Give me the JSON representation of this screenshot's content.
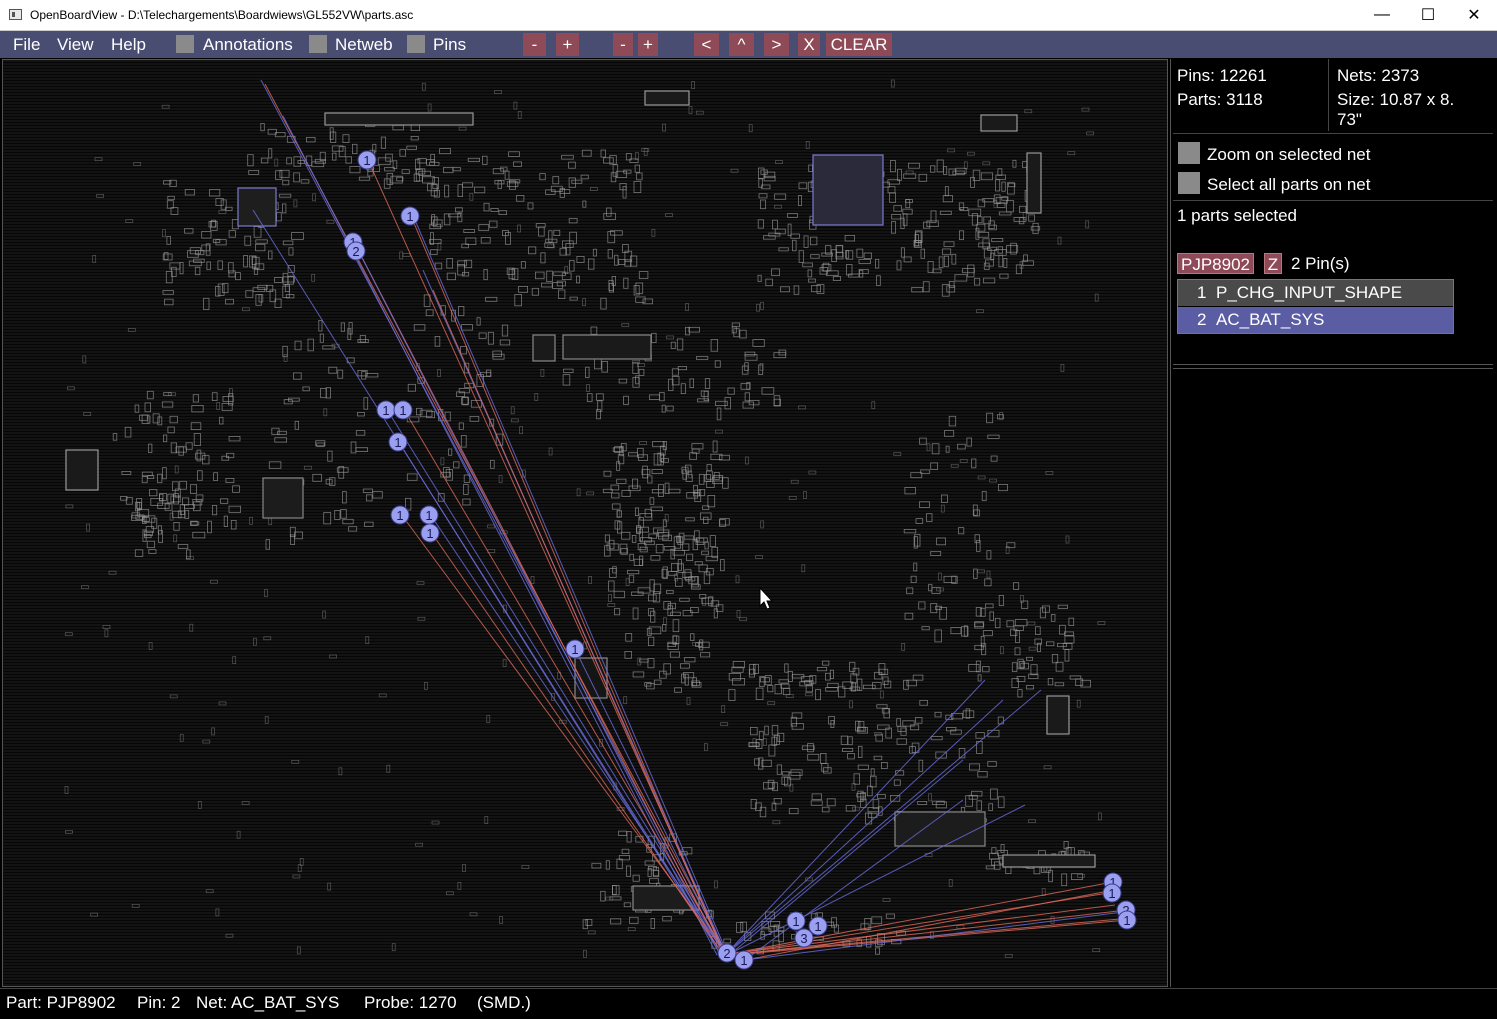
{
  "window": {
    "title": "OpenBoardView - D:\\Telechargements\\Boardwiews\\GL552VW\\parts.asc",
    "minimize_glyph": "—",
    "maximize_glyph": "☐",
    "close_glyph": "✕"
  },
  "menu": {
    "file": "File",
    "view": "View",
    "help": "Help",
    "annotations": "Annotations",
    "netweb": "Netweb",
    "pins": "Pins"
  },
  "toolbar": {
    "minus1": "-",
    "plus1": "+",
    "minus2": "-",
    "plus2": "+",
    "prev": "<",
    "up": "^",
    "next": ">",
    "x": "X",
    "clear": "CLEAR"
  },
  "stats": {
    "pins": "Pins: 12261",
    "parts": "Parts: 3118",
    "nets": "Nets: 2373",
    "size_line1": "Size: 10.87 x 8.",
    "size_line2": "73\""
  },
  "options": {
    "zoom_net": "Zoom on selected net",
    "select_all": "Select all parts on net"
  },
  "selection": {
    "summary": "1 parts selected",
    "part_name": "PJP8902",
    "z_button": "Z",
    "pin_count": "2 Pin(s)",
    "pins": [
      {
        "num": "1",
        "net": "P_CHG_INPUT_SHAPE"
      },
      {
        "num": "2",
        "net": "AC_BAT_SYS"
      }
    ]
  },
  "status": {
    "part": "Part: PJP8902",
    "pin": "Pin: 2",
    "net": "Net: AC_BAT_SYS",
    "probe": "Probe: 1270",
    "type": "(SMD.)"
  },
  "colors": {
    "menu_bg": "#4a4d72",
    "button_bg": "#8e4a57",
    "pin_marker": "#9a9ff0",
    "net_line_blue": "#6b6ee0",
    "net_line_red": "#e06a5a",
    "highlight_row": "#5a5da3"
  },
  "board": {
    "pin_markers": [
      {
        "label": "1"
      },
      {
        "label": "1"
      },
      {
        "label": "1"
      },
      {
        "label": "2"
      },
      {
        "label": "1"
      },
      {
        "label": "1"
      },
      {
        "label": "1"
      },
      {
        "label": "1"
      },
      {
        "label": "1"
      },
      {
        "label": "1"
      },
      {
        "label": "1"
      },
      {
        "label": "2"
      },
      {
        "label": "1"
      },
      {
        "label": "1"
      },
      {
        "label": "1"
      },
      {
        "label": "3"
      },
      {
        "label": "1"
      },
      {
        "label": "1"
      },
      {
        "label": "2"
      },
      {
        "label": "1"
      }
    ]
  }
}
